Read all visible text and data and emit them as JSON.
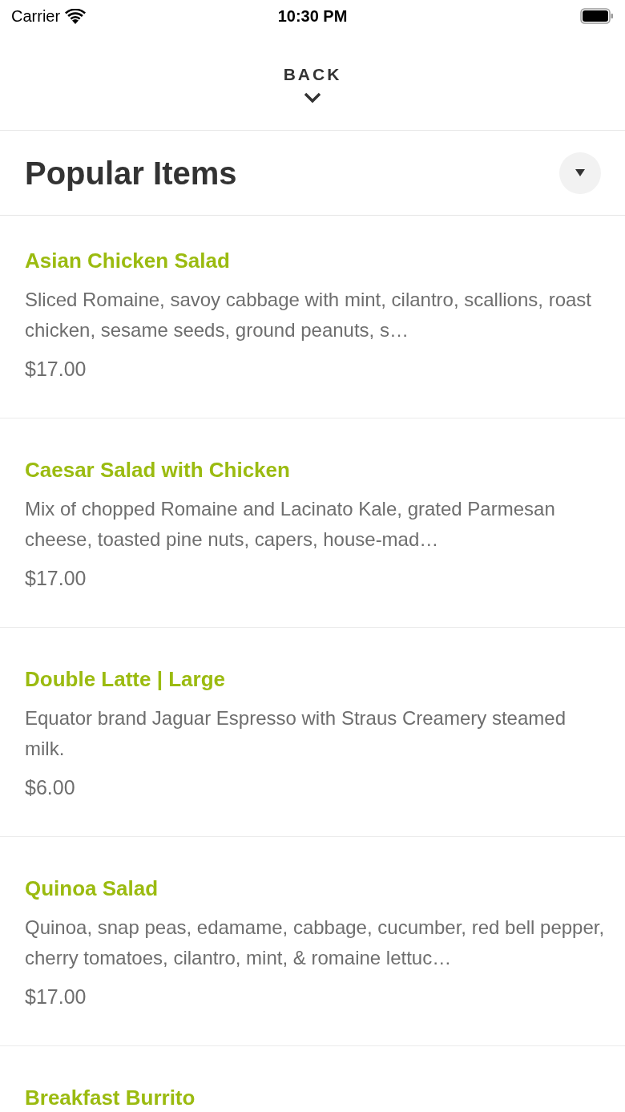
{
  "status_bar": {
    "carrier": "Carrier",
    "time": "10:30 PM"
  },
  "back_button": {
    "label": "BACK"
  },
  "section": {
    "title": "Popular Items"
  },
  "items": [
    {
      "name": "Asian Chicken Salad",
      "description": "Sliced Romaine, savoy cabbage with mint, cilantro, scallions, roast chicken, sesame seeds, ground peanuts, s…",
      "price": "$17.00"
    },
    {
      "name": "Caesar Salad with Chicken",
      "description": "Mix of chopped Romaine and Lacinato Kale, grated Parmesan cheese, toasted pine nuts, capers, house-mad…",
      "price": "$17.00"
    },
    {
      "name": "Double Latte | Large",
      "description": "Equator brand Jaguar Espresso with Straus Creamery steamed milk.",
      "price": "$6.00"
    },
    {
      "name": "Quinoa Salad",
      "description": "Quinoa, snap peas, edamame, cabbage, cucumber, red bell pepper, cherry tomatoes, cilantro, mint, & romaine lettuc…",
      "price": "$17.00"
    },
    {
      "name": "Breakfast Burrito"
    }
  ]
}
